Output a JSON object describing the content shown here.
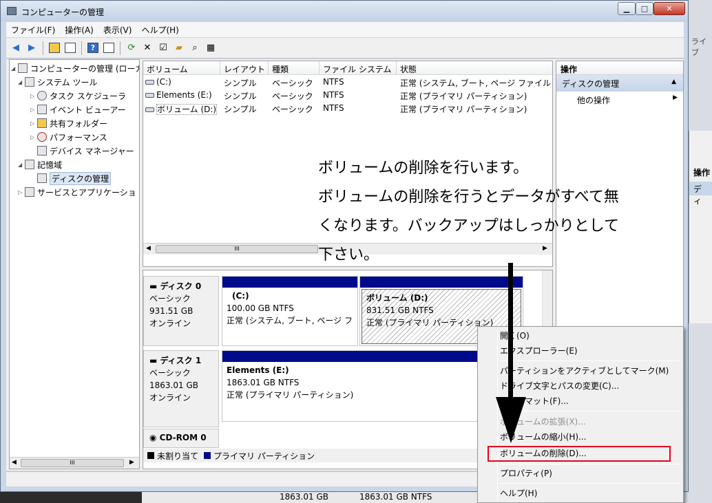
{
  "window": {
    "title": "コンピューターの管理",
    "buttons": {
      "minimize": "▁",
      "maximize": "□",
      "close": "✕"
    }
  },
  "menubar": [
    "ファイル(F)",
    "操作(A)",
    "表示(V)",
    "ヘルプ(H)"
  ],
  "toolbar": [
    "back-arrow-icon",
    "forward-arrow-icon",
    "up-folder-icon",
    "show-hide-tree-icon",
    "help-icon",
    "properties-pane-icon",
    "refresh-icon",
    "delete-icon",
    "properties-icon",
    "open-icon",
    "search-icon",
    "export-icon"
  ],
  "tree": {
    "root": "コンピューターの管理 (ローカ",
    "system_tools": "システム ツール",
    "task_scheduler": "タスク スケジューラ",
    "event_viewer": "イベント ビューアー",
    "shared_folders": "共有フォルダー",
    "performance": "パフォーマンス",
    "device_manager": "デバイス マネージャー",
    "storage": "記憶域",
    "disk_management": "ディスクの管理",
    "services": "サービスとアプリケーショ",
    "scroll_thumb": "III"
  },
  "volume_list": {
    "columns": [
      "ボリューム",
      "レイアウト",
      "種類",
      "ファイル システム",
      "状態"
    ],
    "rows": [
      {
        "volume": "(C:)",
        "layout": "シンプル",
        "type": "ベーシック",
        "fs": "NTFS",
        "status": "正常 (システム, ブート, ページ ファイル"
      },
      {
        "volume": "Elements (E:)",
        "layout": "シンプル",
        "type": "ベーシック",
        "fs": "NTFS",
        "status": "正常 (プライマリ パーティション)"
      },
      {
        "volume": "ボリューム (D:)",
        "layout": "シンプル",
        "type": "ベーシック",
        "fs": "NTFS",
        "status": "正常 (プライマリ パーティション)"
      }
    ],
    "scroll_thumb": "III"
  },
  "disks": {
    "disk0": {
      "name": "ディスク 0",
      "kind": "ベーシック",
      "size": "931.51 GB",
      "state": "オンライン",
      "p1": {
        "name": "(C:)",
        "size": "100.00 GB NTFS",
        "status": "正常 (システム, ブート, ページ フ"
      },
      "p2": {
        "name": "ボリューム (D:)",
        "size": "831.51 GB NTFS",
        "status": "正常 (プライマリ パーティション)"
      }
    },
    "disk1": {
      "name": "ディスク 1",
      "kind": "ベーシック",
      "size": "1863.01 GB",
      "state": "オンライン",
      "p1": {
        "name": "Elements (E:)",
        "size": "1863.01 GB NTFS",
        "status": "正常 (プライマリ パーティション)"
      }
    },
    "cdrom": {
      "name": "CD-ROM 0"
    }
  },
  "legend": {
    "unallocated": "未割り当て",
    "primary": "プライマリ パーティション"
  },
  "actions": {
    "header": "操作",
    "selected": "ディスクの管理",
    "other": "他の操作"
  },
  "annotation": [
    "ボリュームの削除を行います。",
    "ボリュームの削除を行うとデータがすべて無",
    "くなります。バックアップはしっかりとして",
    "下さい。"
  ],
  "context_menu": {
    "open": "開く(O)",
    "explorer": "エクスプローラー(E)",
    "mark_active": "パーティションをアクティブとしてマーク(M)",
    "change_letter": "ドライブ文字とパスの変更(C)...",
    "format": "フォーマット(F)...",
    "extend": "ボリュームの拡張(X)...",
    "shrink": "ボリュームの縮小(H)...",
    "delete": "ボリュームの削除(D)...",
    "properties": "プロパティ(P)",
    "help": "ヘルプ(H)"
  },
  "background": {
    "partial_text": "ライブ",
    "action_label": "操作",
    "di_label": "ディ",
    "bottom_size": "1863.01 GB",
    "bottom_size_fs": "1863.01 GB NTFS"
  },
  "colors": {
    "primary_partition": "#000b8c",
    "highlight_box": "#e6001e"
  }
}
